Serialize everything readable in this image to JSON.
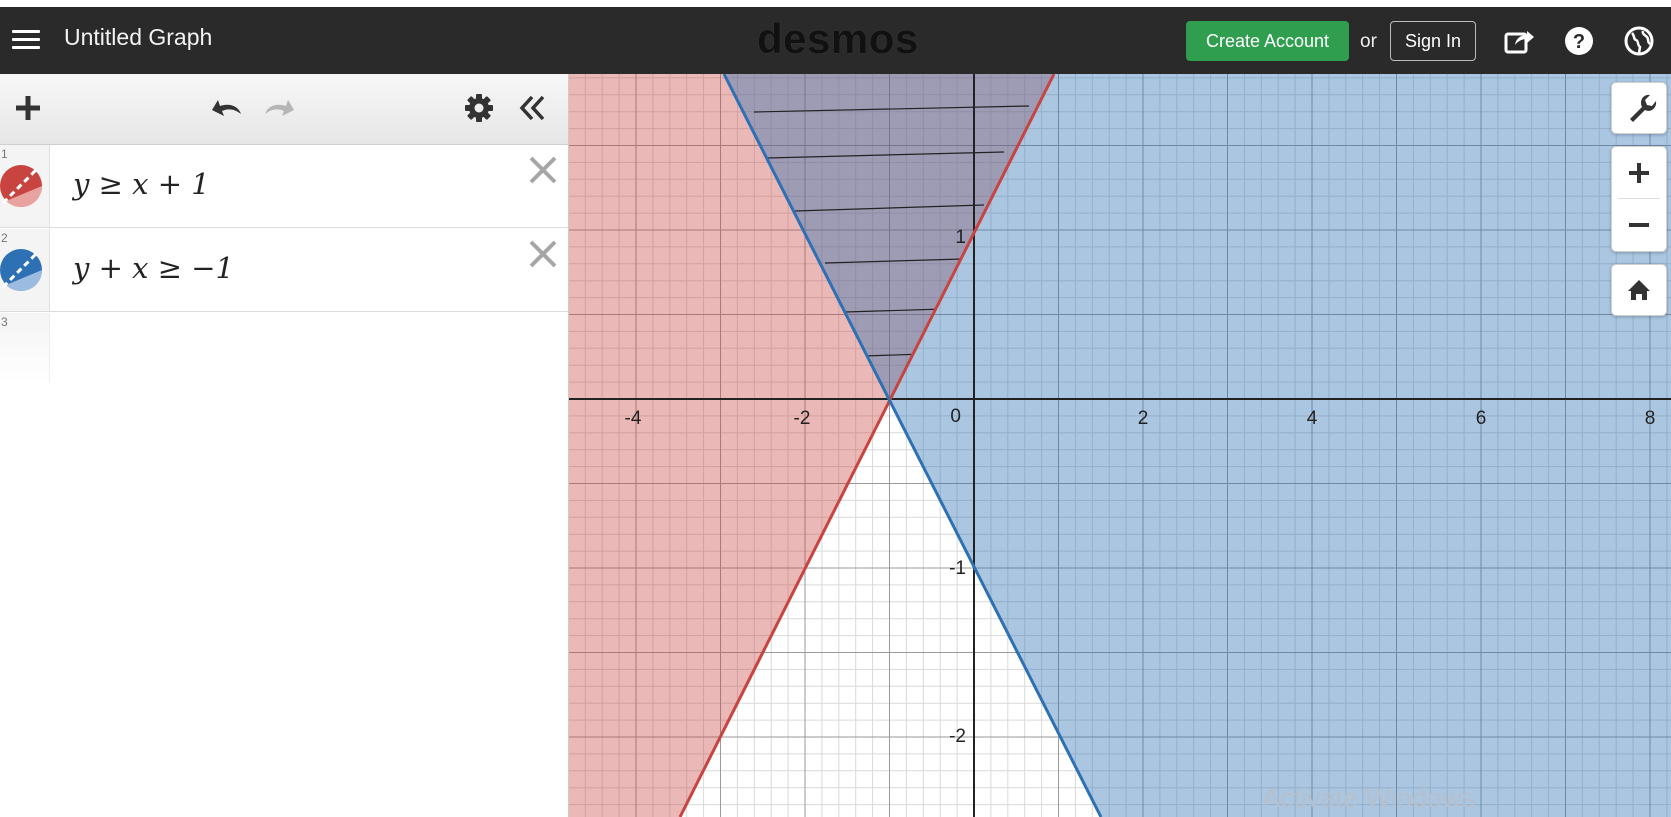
{
  "header": {
    "title": "Untitled Graph",
    "logo": "desmos",
    "create_account": "Create Account",
    "or": "or",
    "sign_in": "Sign In",
    "icons": [
      "menu-icon",
      "share-icon",
      "help-icon",
      "globe-icon"
    ]
  },
  "toolbar": {
    "icons": [
      "add-icon",
      "undo-icon",
      "redo-icon",
      "settings-icon",
      "collapse-icon"
    ]
  },
  "expressions": [
    {
      "number": "1",
      "latex": "y ≥ x + 1",
      "color": "#c74440"
    },
    {
      "number": "2",
      "latex": "y + x ≥ −1",
      "color": "#2d70b3"
    },
    {
      "number": "3",
      "latex": "",
      "color": ""
    }
  ],
  "graph": {
    "x_ticks": [
      "-4",
      "-2",
      "0",
      "2",
      "4",
      "6",
      "8"
    ],
    "y_ticks": [
      "1",
      "-1",
      "-2"
    ],
    "origin_label": "0",
    "side_buttons": [
      "wrench-icon",
      "zoom-in-icon",
      "zoom-out-icon",
      "home-icon"
    ],
    "watermark": "Activate Windows"
  },
  "colors": {
    "red": "#c74440",
    "blue": "#2d70b3",
    "green_button": "#2f9e4f",
    "header_bg": "#2a2a2a"
  }
}
